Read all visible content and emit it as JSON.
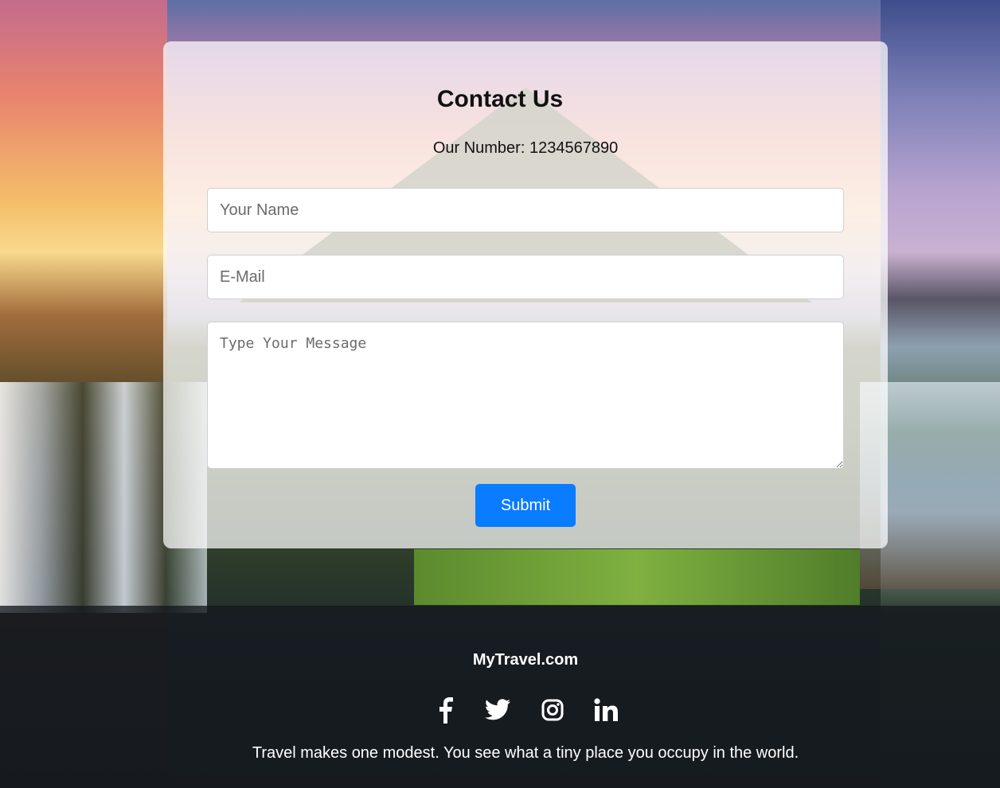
{
  "contact": {
    "title": "Contact Us",
    "number_text": "Our Number: 1234567890",
    "name_placeholder": "Your Name",
    "email_placeholder": "E-Mail",
    "message_placeholder": "Type Your Message",
    "submit_label": "Submit"
  },
  "footer": {
    "brand": "MyTravel.com",
    "socials": [
      "facebook-icon",
      "twitter-icon",
      "instagram-icon",
      "linkedin-icon"
    ],
    "tagline": "Travel makes one modest. You see what a tiny place you occupy in the world."
  },
  "colors": {
    "accent": "#0a7cff",
    "footer_bg": "#14181e"
  }
}
